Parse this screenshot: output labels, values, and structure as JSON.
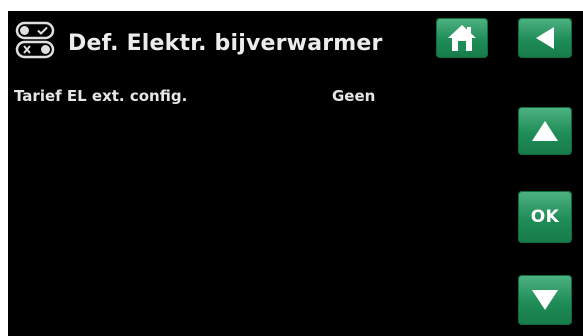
{
  "header": {
    "title": "Def. Elektr. bijverwarmer",
    "settings_icon": "toggle-settings-icon"
  },
  "rows": [
    {
      "label": "Tarief EL ext. config.",
      "value": "Geen"
    }
  ],
  "buttons": {
    "home": {
      "icon": "home-icon"
    },
    "back": {
      "icon": "back-arrow-icon"
    },
    "up": {
      "icon": "up-arrow-icon"
    },
    "ok": {
      "label": "OK"
    },
    "down": {
      "icon": "down-arrow-icon"
    }
  },
  "colors": {
    "background": "#000000",
    "text": "#ececec",
    "button_green": "#1f8d58"
  }
}
